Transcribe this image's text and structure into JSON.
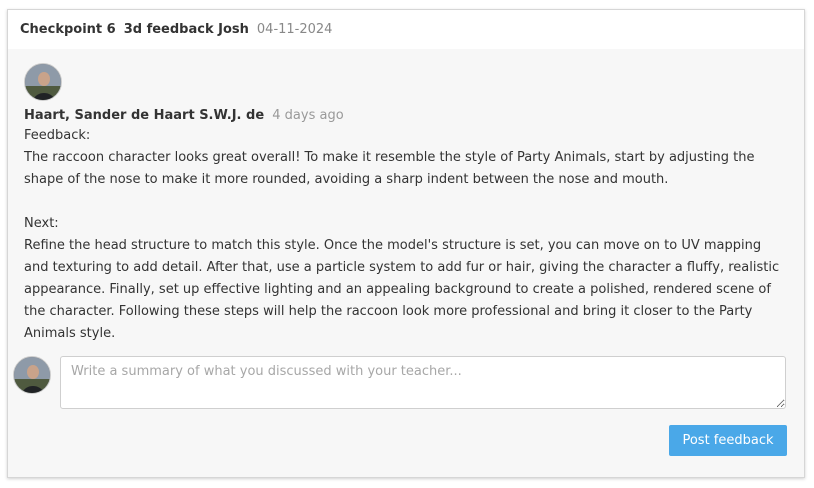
{
  "header": {
    "checkpoint": "Checkpoint 6",
    "title": "3d feedback Josh",
    "date": "04-11-2024"
  },
  "comment": {
    "author": "Haart, Sander de Haart S.W.J. de",
    "time": "4 days ago",
    "body": "Feedback:\nThe raccoon character looks great overall! To make it resemble the style of Party Animals, start by adjusting the shape of the nose to make it more rounded, avoiding a sharp indent between the nose and mouth.\n\nNext:\nRefine the head structure to match this style. Once the model's structure is set, you can move on to UV mapping and texturing to add detail. After that, use a particle system to add fur or hair, giving the character a fluffy, realistic appearance. Finally, set up effective lighting and an appealing background to create a polished, rendered scene of the character. Following these steps will help the raccoon look more professional and bring it closer to the Party Animals style."
  },
  "reply": {
    "placeholder": "Write a summary of what you discussed with your teacher...",
    "value": "",
    "submit_label": "Post feedback"
  },
  "colors": {
    "accent": "#4aa8e8",
    "muted_text": "#888888"
  },
  "icons": [
    "avatar-photo"
  ]
}
